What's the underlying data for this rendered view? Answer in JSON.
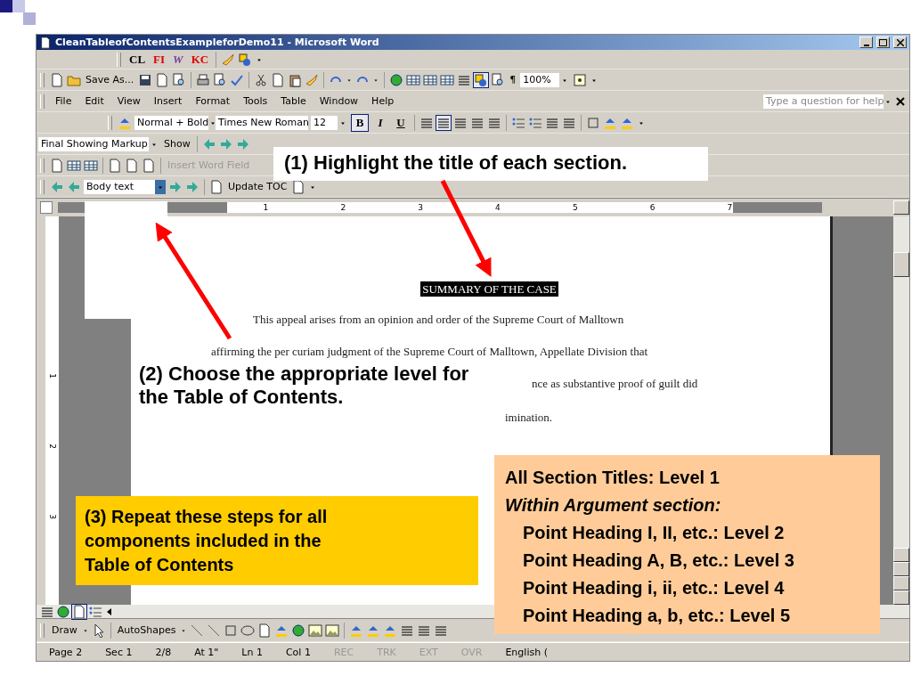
{
  "window": {
    "title": "CleanTableofContentsExampleforDemo11 - Microsoft Word"
  },
  "custom_toolbar": {
    "buttons": [
      {
        "text": "CL",
        "kind": "cl"
      },
      {
        "text": "FI",
        "kind": "red"
      },
      {
        "text": "W",
        "kind": "w"
      },
      {
        "text": "KC",
        "kind": "red"
      }
    ]
  },
  "standard_toolbar": {
    "save_as": "Save As...",
    "pilcrow": "¶",
    "zoom": "100%"
  },
  "menu_bar": {
    "items": [
      "File",
      "Edit",
      "View",
      "Insert",
      "Format",
      "Tools",
      "Table",
      "Window",
      "Help"
    ],
    "help_placeholder": "Type a question for help"
  },
  "formatting_toolbar": {
    "style": "Normal + Bold",
    "font": "Times New Roman",
    "size": "12",
    "bold": {
      "label": "B",
      "pressed": true
    },
    "italic": {
      "label": "I",
      "pressed": false
    },
    "underline": {
      "label": "U",
      "pressed": false
    },
    "alignments": [
      {
        "selected": false
      },
      {
        "selected": true
      },
      {
        "selected": false
      },
      {
        "selected": false
      }
    ]
  },
  "reviewing_toolbar": {
    "display": "Final Showing Markup",
    "show": "Show"
  },
  "mail_merge_toolbar": {
    "insert_word_field": "Insert Word Field"
  },
  "outlining_toolbar": {
    "level": "Body text",
    "update_toc": "Update TOC"
  },
  "ruler": {
    "labels": [
      "1",
      "2",
      "3",
      "4",
      "5",
      "6",
      "7"
    ],
    "vertical_labels": [
      "1",
      "2",
      "3"
    ]
  },
  "document": {
    "heading": "SUMMARY OF THE CASE",
    "lines": [
      {
        "text": "This appeal arises from an opinion and order of the Supreme Court of Malltown",
        "kind": "first"
      },
      {
        "text": "affirming the per curiam judgment of the Supreme Court of Malltown, Appellate Division that",
        "kind": "full"
      },
      {
        "text": "nce as substantive proof of guilt did",
        "kind": "tail"
      },
      {
        "text": "imination.",
        "kind": "tail"
      }
    ]
  },
  "drawing_toolbar": {
    "draw": "Draw",
    "autoshapes": "AutoShapes"
  },
  "status_bar": {
    "fields": [
      {
        "text": "Page 2",
        "dim": false
      },
      {
        "text": "Sec 1",
        "dim": false
      },
      {
        "text": "2/8",
        "dim": false
      },
      {
        "text": "At 1\"",
        "dim": false
      },
      {
        "text": "Ln 1",
        "dim": false
      },
      {
        "text": "Col 1",
        "dim": false
      },
      {
        "text": "REC",
        "dim": true
      },
      {
        "text": "TRK",
        "dim": true
      },
      {
        "text": "EXT",
        "dim": true
      },
      {
        "text": "OVR",
        "dim": true
      },
      {
        "text": "English (",
        "dim": false
      }
    ]
  },
  "callouts": [
    {
      "kind": "white",
      "lines": [
        {
          "text": "(1) Highlight the title of each section.",
          "kind": "plain"
        }
      ]
    },
    {
      "kind": "white",
      "lines": [
        {
          "text": "(2) Choose the appropriate level for",
          "kind": "plain"
        },
        {
          "text": "the Table of Contents.",
          "kind": "plain"
        }
      ]
    },
    {
      "kind": "yellow",
      "lines": [
        {
          "text": "(3) Repeat these steps for all",
          "kind": "plain"
        },
        {
          "text": "components included in the",
          "kind": "plain"
        },
        {
          "text": "Table of Contents",
          "kind": "plain"
        }
      ]
    },
    {
      "kind": "peach",
      "lines": [
        {
          "text": "All Section Titles: Level 1",
          "kind": "plain"
        },
        {
          "text": "Within Argument section:",
          "kind": "italic"
        },
        {
          "text": "Point Heading I, II, etc.: Level 2",
          "kind": "indented"
        },
        {
          "text": "Point Heading A, B, etc.: Level 3",
          "kind": "indented"
        },
        {
          "text": "Point Heading i, ii, etc.: Level 4",
          "kind": "indented"
        },
        {
          "text": "Point Heading a, b, etc.: Level 5",
          "kind": "indented"
        }
      ]
    }
  ]
}
